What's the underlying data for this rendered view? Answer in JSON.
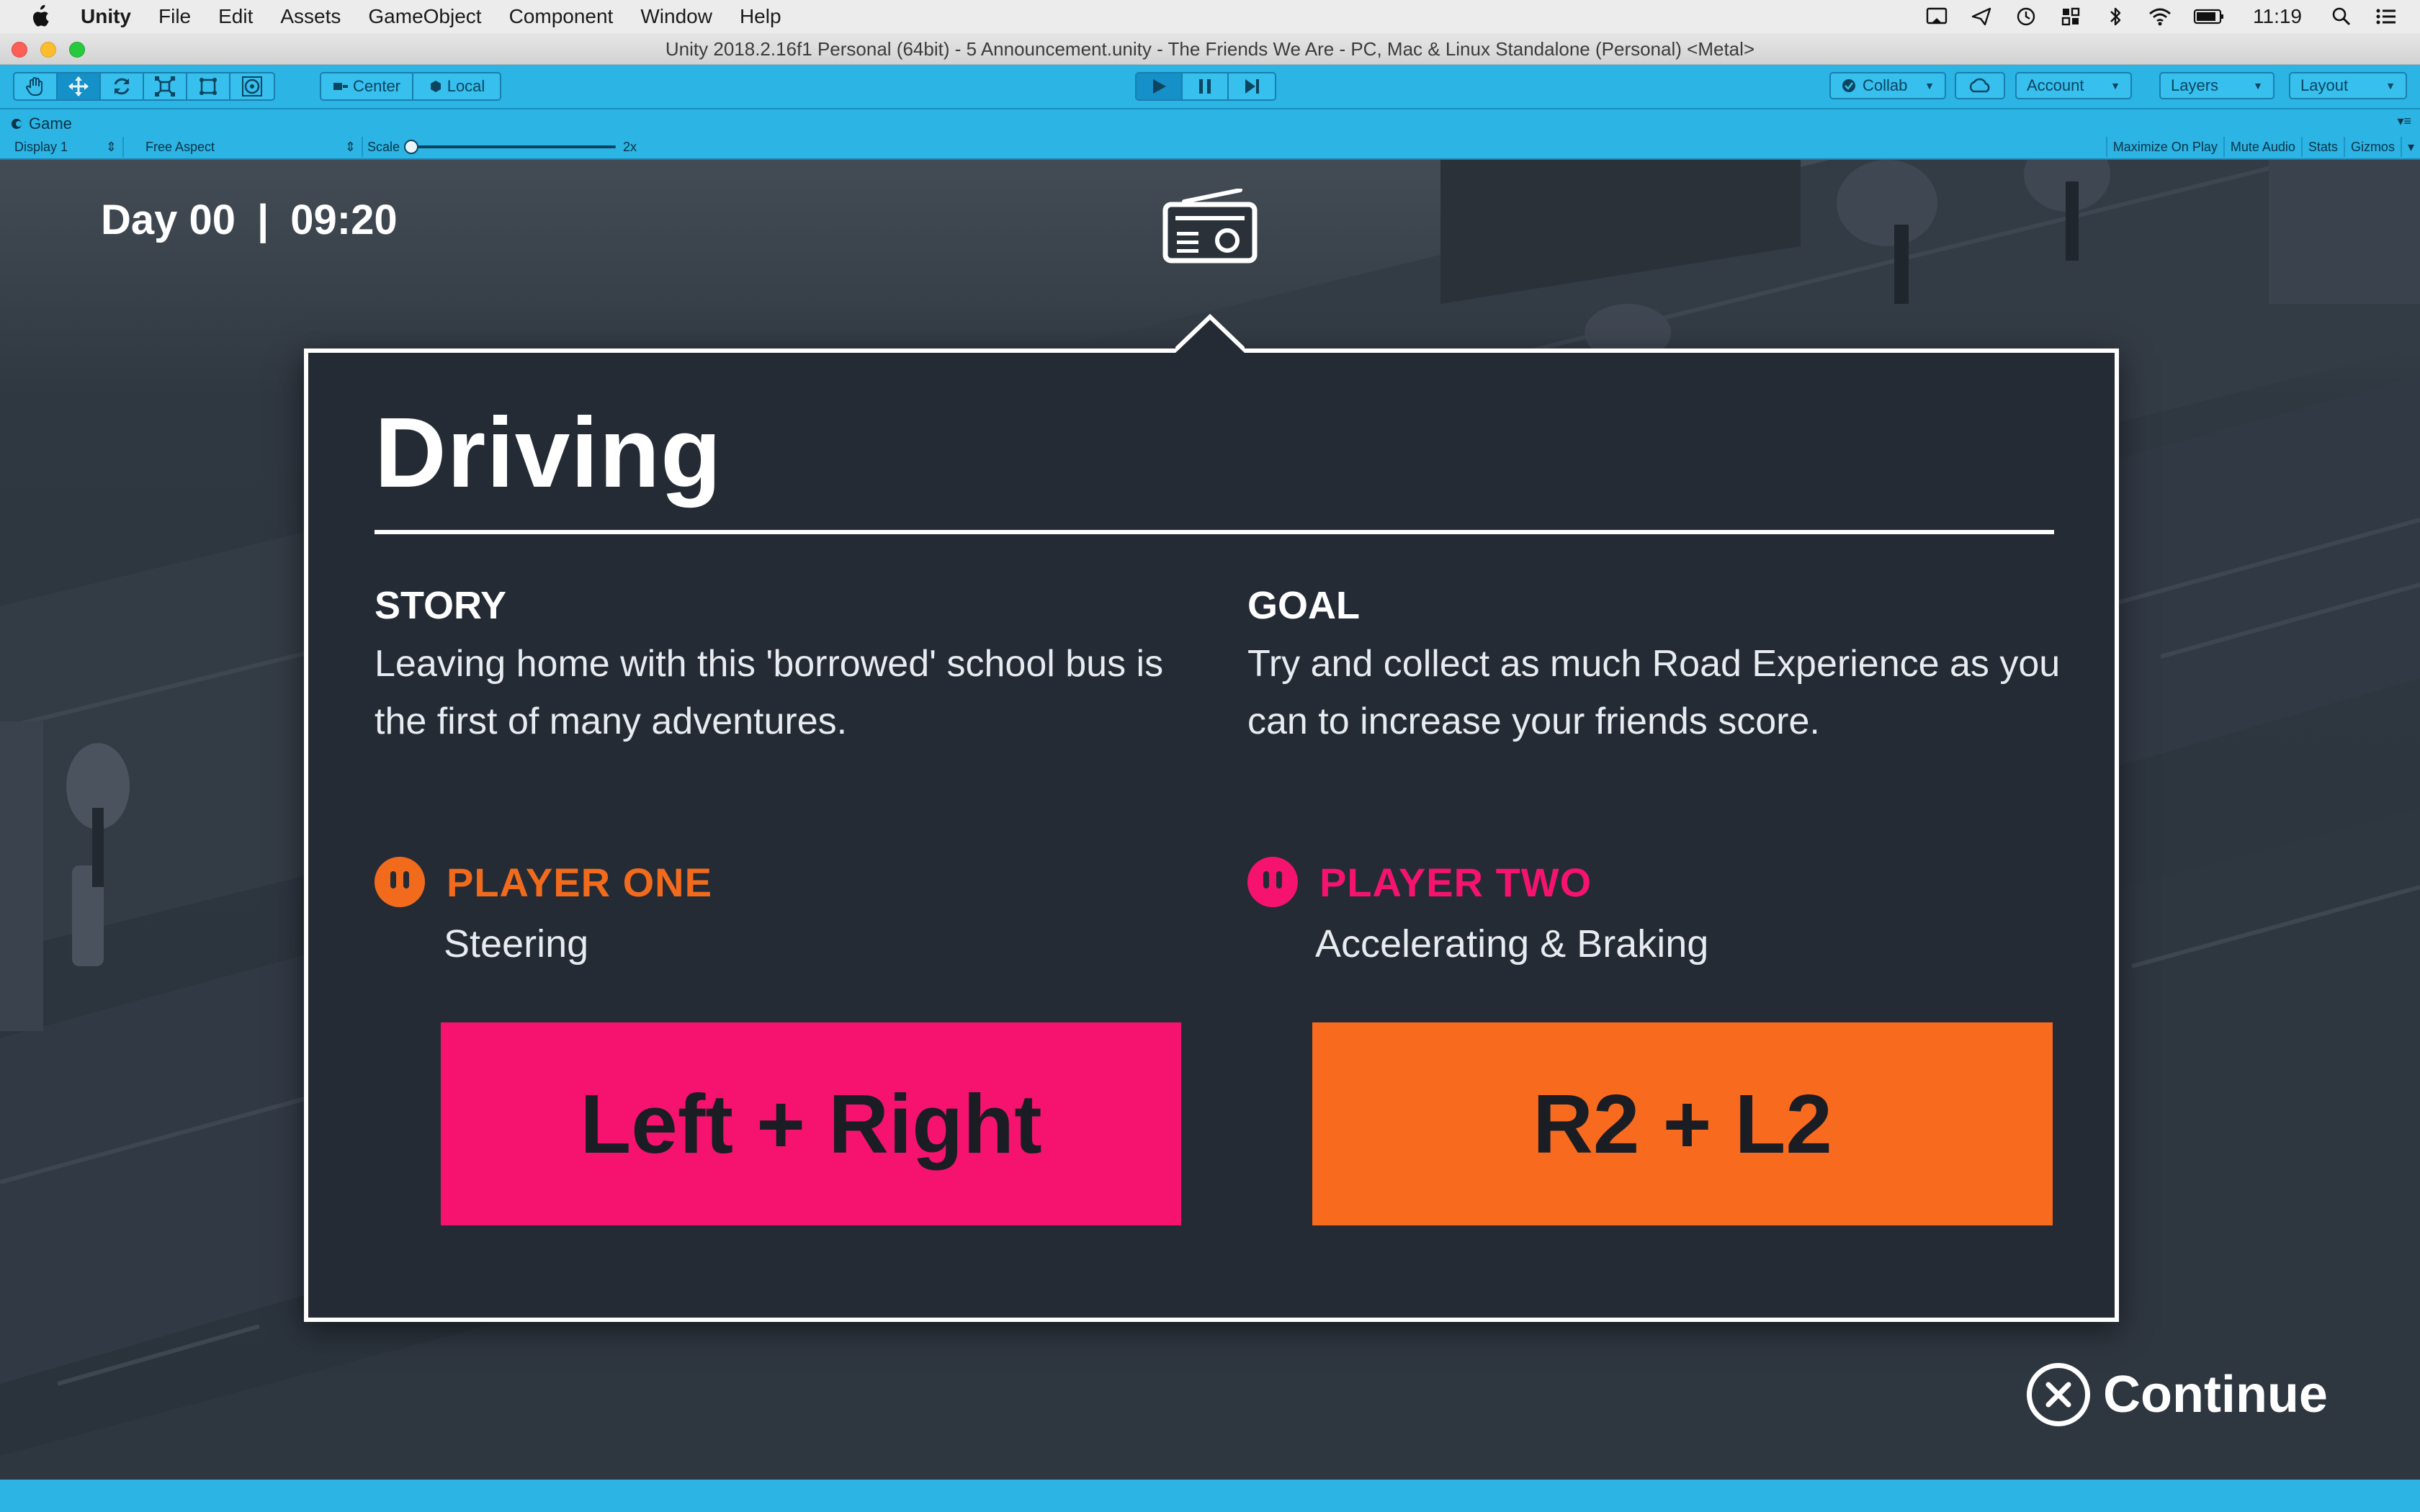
{
  "menubar": {
    "app_name": "Unity",
    "items": [
      "File",
      "Edit",
      "Assets",
      "GameObject",
      "Component",
      "Window",
      "Help"
    ],
    "status_icons": [
      "cast-icon",
      "send-icon",
      "time-machine-icon",
      "grid-icon",
      "bluetooth-icon",
      "wifi-icon",
      "battery-icon"
    ],
    "clock": "11:19"
  },
  "window": {
    "title": "Unity 2018.2.16f1 Personal (64bit) - 5 Announcement.unity - The Friends We Are - PC, Mac & Linux Standalone (Personal) <Metal>"
  },
  "toolbar": {
    "pivot_label": "Center",
    "space_label": "Local",
    "collab_label": "Collab",
    "account_label": "Account",
    "layers_label": "Layers",
    "layout_label": "Layout"
  },
  "game_view": {
    "tab_label": "Game",
    "display_label": "Display 1",
    "aspect_label": "Free Aspect",
    "scale_label": "Scale",
    "scale_value": "2x",
    "maximize_label": "Maximize On Play",
    "mute_label": "Mute Audio",
    "stats_label": "Stats",
    "gizmos_label": "Gizmos"
  },
  "hud": {
    "day": "Day 00",
    "separator": "|",
    "time": "09:20"
  },
  "dialog": {
    "title": "Driving",
    "story_heading": "STORY",
    "story_text": "Leaving home with this 'borrowed' school bus is the first of many adventures.",
    "goal_heading": "GOAL",
    "goal_text": "Try and collect as much Road Experience as you can to increase your friends score.",
    "player_one": {
      "name": "PLAYER ONE",
      "action": "Steering",
      "keys": "Left + Right",
      "color": "#f26b1d",
      "key_color": "#f5136f"
    },
    "player_two": {
      "name": "PLAYER TWO",
      "action": "Accelerating & Braking",
      "keys": "R2 + L2",
      "color": "#f5136f",
      "key_color": "#f86b1f"
    }
  },
  "continue_label": "Continue",
  "colors": {
    "unity_accent": "#2bb4e4",
    "dialog_bg": "#242b35",
    "player_one": "#f26b1d",
    "player_two": "#f5136f"
  }
}
